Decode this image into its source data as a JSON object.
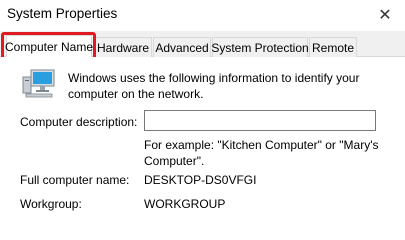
{
  "window": {
    "title": "System Properties",
    "close_glyph": "✕"
  },
  "tabs": [
    {
      "label": "Computer Name",
      "active": true
    },
    {
      "label": "Hardware",
      "active": false
    },
    {
      "label": "Advanced",
      "active": false
    },
    {
      "label": "System Protection",
      "active": false
    },
    {
      "label": "Remote",
      "active": false
    }
  ],
  "highlight_color": "#e01a22",
  "computer_name_tab": {
    "icon": "computer-icon",
    "intro": "Windows uses the following information to identify your computer on the network.",
    "description_label": "Computer description:",
    "description_value": "",
    "description_hint": "For example: \"Kitchen Computer\" or \"Mary's Computer\".",
    "full_name_label": "Full computer name:",
    "full_name_value": "DESKTOP-DS0VFGI",
    "workgroup_label": "Workgroup:",
    "workgroup_value": "WORKGROUP"
  }
}
